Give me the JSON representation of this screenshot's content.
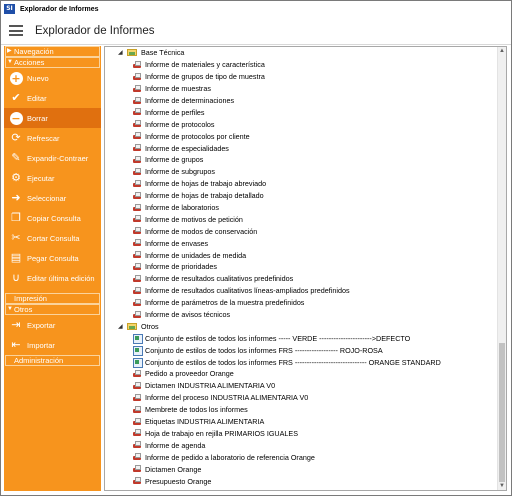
{
  "window": {
    "title": "Explorador de Informes",
    "icon_text": "SI"
  },
  "header": {
    "title": "Explorador de Informes"
  },
  "sidebar": {
    "sections": {
      "navegacion": "Navegación",
      "acciones": "Acciones",
      "impresion": "Impresión",
      "otros": "Otros",
      "administracion": "Administración"
    },
    "acciones": [
      {
        "label": "Nuevo",
        "icon": "plus-circle-icon",
        "glyph": "+"
      },
      {
        "label": "Editar",
        "icon": "check-icon",
        "glyph": "✔"
      },
      {
        "label": "Borrar",
        "icon": "minus-circle-icon",
        "glyph": "−"
      },
      {
        "label": "Refrescar",
        "icon": "refresh-icon",
        "glyph": "⟳"
      },
      {
        "label": "Expandir-Contraer",
        "icon": "wrench-icon",
        "glyph": "✎"
      },
      {
        "label": "Ejecutar",
        "icon": "gear-icon",
        "glyph": "⚙"
      },
      {
        "label": "Seleccionar",
        "icon": "pointer-icon",
        "glyph": "➜"
      },
      {
        "label": "Copiar Consulta",
        "icon": "copy-icon",
        "glyph": "❐"
      },
      {
        "label": "Cortar Consulta",
        "icon": "scissors-icon",
        "glyph": "✂"
      },
      {
        "label": "Pegar Consulta",
        "icon": "paste-icon",
        "glyph": "▤"
      },
      {
        "label": "Editar última edición",
        "icon": "magnet-icon",
        "glyph": "∪"
      }
    ],
    "otros": [
      {
        "label": "Exportar",
        "icon": "export-icon",
        "glyph": "⇥"
      },
      {
        "label": "Importar",
        "icon": "import-icon",
        "glyph": "⇤"
      }
    ]
  },
  "tree": {
    "groups": [
      {
        "label": "Base Técnica",
        "items": [
          {
            "label": "Informe de materiales y característica",
            "icon": "printer-icon"
          },
          {
            "label": "Informe de grupos de tipo de muestra",
            "icon": "printer-icon"
          },
          {
            "label": "Informe de muestras",
            "icon": "printer-icon"
          },
          {
            "label": "Informe de determinaciones",
            "icon": "printer-icon"
          },
          {
            "label": "Informe de perfiles",
            "icon": "printer-icon"
          },
          {
            "label": "Informe de protocolos",
            "icon": "printer-icon"
          },
          {
            "label": "Informe de protocolos por cliente",
            "icon": "printer-icon"
          },
          {
            "label": "Informe de especialidades",
            "icon": "printer-icon"
          },
          {
            "label": "Informe de grupos",
            "icon": "printer-icon"
          },
          {
            "label": "Informe de subgrupos",
            "icon": "printer-icon"
          },
          {
            "label": "Informe de hojas de trabajo abreviado",
            "icon": "printer-icon"
          },
          {
            "label": "Informe de hojas de trabajo detallado",
            "icon": "printer-icon"
          },
          {
            "label": "Informe de laboratorios",
            "icon": "printer-icon"
          },
          {
            "label": "Informe de motivos de petición",
            "icon": "printer-icon"
          },
          {
            "label": "Informe de modos de conservación",
            "icon": "printer-icon"
          },
          {
            "label": "Informe de envases",
            "icon": "printer-icon"
          },
          {
            "label": "Informe de unidades de medida",
            "icon": "printer-icon"
          },
          {
            "label": "Informe de prioridades",
            "icon": "printer-icon"
          },
          {
            "label": "Informe de resultados cualitativos predefinidos",
            "icon": "printer-icon"
          },
          {
            "label": "Informe de resultados cualitativos líneas-ampliados predefinidos",
            "icon": "printer-icon"
          },
          {
            "label": "Informe de parámetros de la muestra predefinidos",
            "icon": "printer-icon"
          },
          {
            "label": "Informe de avisos técnicos",
            "icon": "printer-icon"
          }
        ]
      },
      {
        "label": "Otros",
        "items": [
          {
            "label": "Conjunto de estilos de todos los informes ----- VERDE  ---------------------->DEFECTO",
            "icon": "style-icon"
          },
          {
            "label": "Conjunto de estilos de todos los informes FRS   ------------------  ROJO-ROSA",
            "icon": "style-icon"
          },
          {
            "label": "Conjunto de estilos de todos los informes FRS   ------------------------------ ORANGE STANDARD",
            "icon": "style-icon"
          },
          {
            "label": "Pedido a proveedor Orange",
            "icon": "printer-icon"
          },
          {
            "label": "Dictamen INDUSTRIA ALIMENTARIA V0",
            "icon": "printer-icon"
          },
          {
            "label": "Informe del proceso INDUSTRIA ALIMENTARIA V0",
            "icon": "printer-icon"
          },
          {
            "label": "Membrete de todos los informes",
            "icon": "printer-icon"
          },
          {
            "label": "Etiquetas INDUSTRIA ALIMENTARIA",
            "icon": "printer-icon"
          },
          {
            "label": "Hoja de trabajo en rejilla PRIMARIOS IGUALES",
            "icon": "printer-icon"
          },
          {
            "label": "Informe de agenda",
            "icon": "printer-icon"
          },
          {
            "label": "Informe de pedido a laboratorio de referencia Orange",
            "icon": "printer-icon"
          },
          {
            "label": "Dictamen Orange",
            "icon": "printer-icon"
          },
          {
            "label": "Presupuesto Orange",
            "icon": "printer-icon"
          }
        ]
      }
    ]
  },
  "colors": {
    "sidebar": "#f7941d",
    "sidebar_selected": "#e0700f",
    "report_icon": "#c0392b"
  }
}
